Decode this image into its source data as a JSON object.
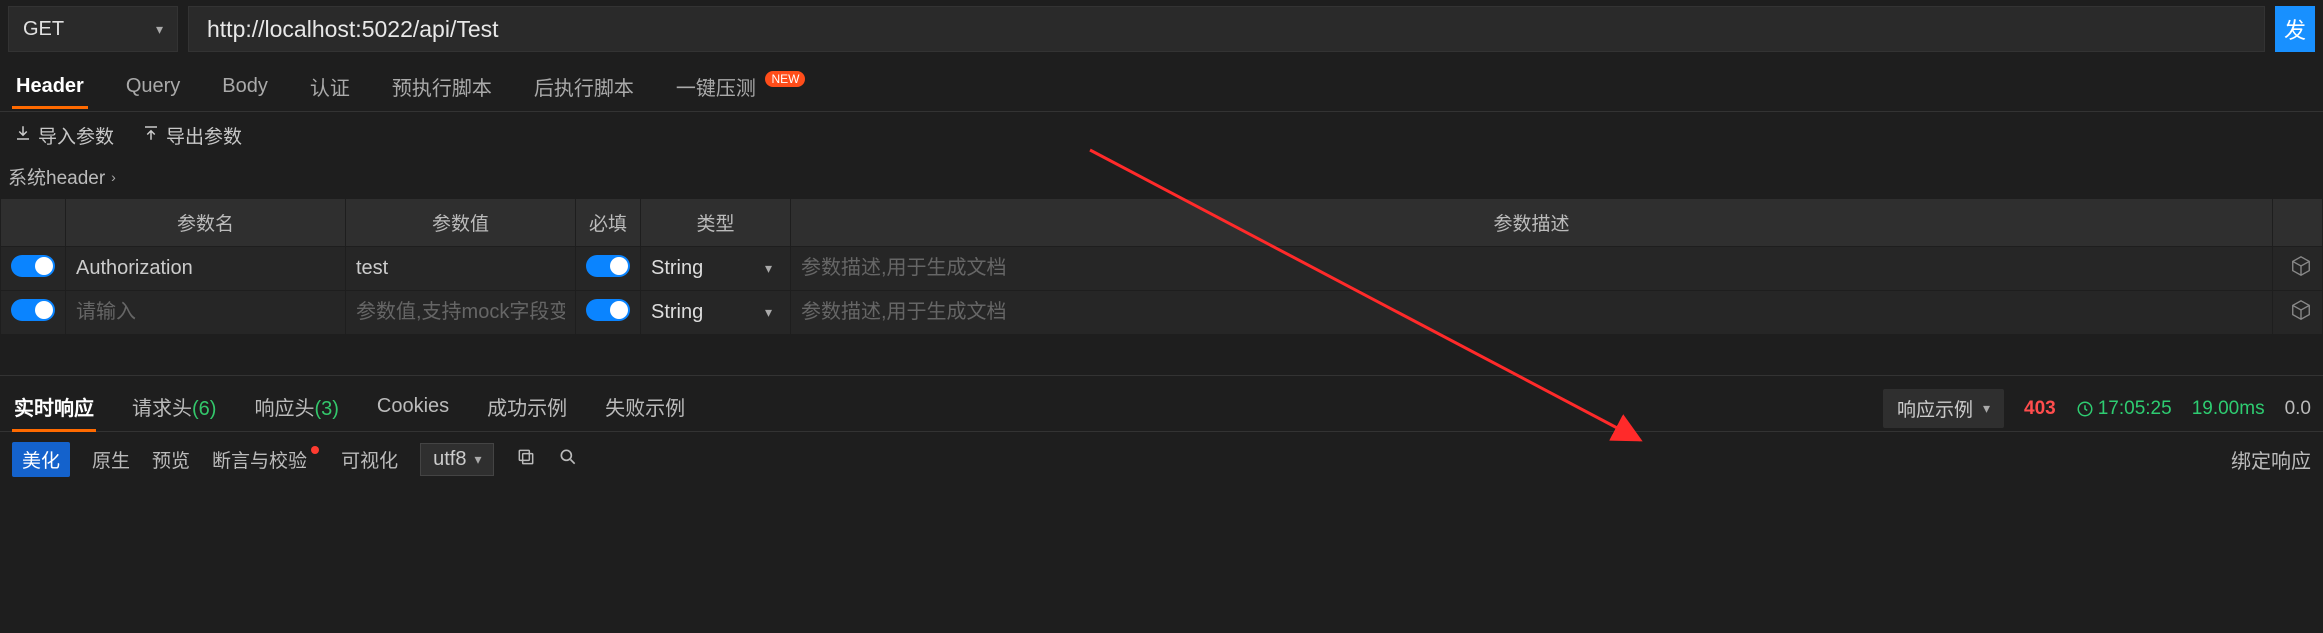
{
  "request": {
    "method": "GET",
    "url": "http://localhost:5022/api/Test",
    "send_label": "发"
  },
  "tabs": {
    "header": "Header",
    "query": "Query",
    "body": "Body",
    "auth": "认证",
    "pre_script": "预执行脚本",
    "post_script": "后执行脚本",
    "stress": "一键压测",
    "new_badge": "NEW"
  },
  "io": {
    "import": "导入参数",
    "export": "导出参数"
  },
  "section": {
    "title": "系统header"
  },
  "table": {
    "headers": {
      "name": "参数名",
      "value": "参数值",
      "required": "必填",
      "type": "类型",
      "desc": "参数描述"
    },
    "rows": [
      {
        "enabled": true,
        "name": "Authorization",
        "name_placeholder": "请输入",
        "value": "test",
        "value_placeholder": "参数值,支持mock字段变",
        "required": true,
        "type": "String",
        "desc": "",
        "desc_placeholder": "参数描述,用于生成文档"
      },
      {
        "enabled": true,
        "name": "",
        "name_placeholder": "请输入",
        "value": "",
        "value_placeholder": "参数值,支持mock字段变",
        "required": true,
        "type": "String",
        "desc": "",
        "desc_placeholder": "参数描述,用于生成文档"
      }
    ]
  },
  "response_tabs": {
    "live": "实时响应",
    "req_headers_label": "请求头",
    "req_headers_count": "(6)",
    "resp_headers_label": "响应头",
    "resp_headers_count": "(3)",
    "cookies": "Cookies",
    "success_ex": "成功示例",
    "fail_ex": "失败示例"
  },
  "response_meta": {
    "example_btn": "响应示例",
    "status": "403",
    "time": "17:05:25",
    "duration": "19.00ms",
    "size": "0.0"
  },
  "format_bar": {
    "beautify": "美化",
    "raw": "原生",
    "preview": "预览",
    "assert": "断言与校验",
    "visualize": "可视化",
    "encoding": "utf8",
    "bind_resp": "绑定响应"
  }
}
